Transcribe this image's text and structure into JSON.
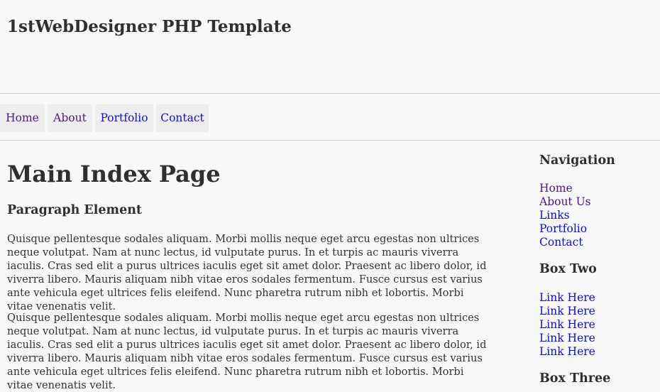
{
  "header": {
    "site_title": "1stWebDesigner PHP Template"
  },
  "nav": {
    "items": [
      {
        "label": "Home"
      },
      {
        "label": "About"
      },
      {
        "label": "Portfolio"
      },
      {
        "label": "Contact"
      }
    ]
  },
  "main": {
    "title": "Main Index Page",
    "section_heading": "Paragraph Element",
    "paragraphs": [
      "Quisque pellentesque sodales aliquam. Morbi mollis neque eget arcu egestas non ultrices neque volutpat. Nam at nunc lectus, id vulputate purus. In et turpis ac mauris viverra iaculis. Cras sed elit a purus ultrices iaculis eget sit amet dolor. Praesent ac libero dolor, id viverra libero. Mauris aliquam nibh vitae eros sodales fermentum. Fusce cursus est varius ante vehicula eget ultrices felis eleifend. Nunc pharetra rutrum nibh et lobortis. Morbi vitae venenatis velit.",
      "Quisque pellentesque sodales aliquam. Morbi mollis neque eget arcu egestas non ultrices neque volutpat. Nam at nunc lectus, id vulputate purus. In et turpis ac mauris viverra iaculis. Cras sed elit a purus ultrices iaculis eget sit amet dolor. Praesent ac libero dolor, id viverra libero. Mauris aliquam nibh vitae eros sodales fermentum. Fusce cursus est varius ante vehicula eget ultrices felis eleifend. Nunc pharetra rutrum nibh et lobortis. Morbi vitae venenatis velit."
    ]
  },
  "sidebar": {
    "navigation": {
      "heading": "Navigation",
      "links": [
        {
          "label": "Home"
        },
        {
          "label": "About Us"
        },
        {
          "label": "Links"
        },
        {
          "label": "Portfolio"
        },
        {
          "label": "Contact"
        }
      ]
    },
    "box_two": {
      "heading": "Box Two",
      "links": [
        {
          "label": "Link Here"
        },
        {
          "label": "Link Here"
        },
        {
          "label": "Link Here"
        },
        {
          "label": "Link Here"
        },
        {
          "label": "Link Here"
        }
      ]
    },
    "box_three": {
      "heading": "Box Three"
    }
  },
  "colors": {
    "background": "#f8f8f8",
    "text": "#333333",
    "link": "#1010c8",
    "visited_link": "#4b1a82",
    "nav_button_bg": "#eeeeee",
    "divider": "#cfcfcf"
  }
}
